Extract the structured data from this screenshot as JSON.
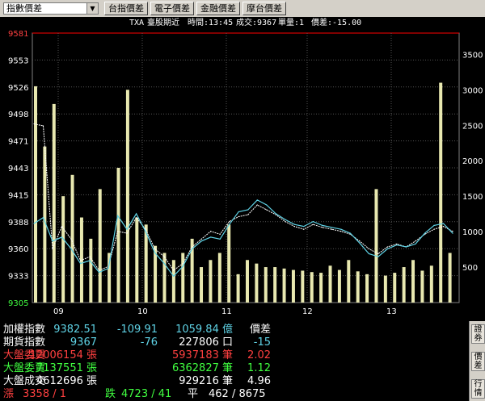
{
  "toolbar": {
    "select_value": "指數價差",
    "buttons": [
      "台指價差",
      "電子價差",
      "金融價差",
      "摩台價差"
    ]
  },
  "header": {
    "symbol": "TXA",
    "name": "臺股期近",
    "time": "時間:13:45",
    "volume": "成交:9367",
    "unit": "單量:1",
    "spread": "價差:-15.00"
  },
  "chart_data": {
    "type": "line",
    "y_ticks": [
      "9581",
      "9553",
      "9526",
      "9498",
      "9471",
      "9443",
      "9415",
      "9388",
      "9360",
      "9333",
      "9305"
    ],
    "y_range": [
      9305,
      9581
    ],
    "y2_ticks": [
      "3500",
      "3000",
      "2500",
      "2000",
      "1500",
      "1000",
      "500"
    ],
    "y2_range": [
      0,
      3800
    ],
    "x_ticks": [
      "09",
      "10",
      "11",
      "12",
      "13"
    ],
    "series": [
      {
        "color": "#ffffff",
        "values": [
          9488,
          9486,
          9360,
          9383,
          9370,
          9348,
          9352,
          9338,
          9342,
          9378,
          9376,
          9392,
          9380,
          9360,
          9352,
          9338,
          9345,
          9362,
          9370,
          9378,
          9375,
          9388,
          9393,
          9395,
          9405,
          9400,
          9395,
          9388,
          9383,
          9380,
          9385,
          9382,
          9380,
          9378,
          9375,
          9368,
          9360,
          9355,
          9362,
          9365,
          9362,
          9368,
          9375,
          9380,
          9383,
          9378
        ]
      },
      {
        "color": "#5fd3e6",
        "values": [
          9386,
          9392,
          9368,
          9372,
          9360,
          9345,
          9348,
          9336,
          9340,
          9394,
          9380,
          9396,
          9378,
          9356,
          9345,
          9332,
          9342,
          9360,
          9368,
          9372,
          9370,
          9385,
          9398,
          9400,
          9410,
          9405,
          9396,
          9390,
          9385,
          9383,
          9388,
          9384,
          9382,
          9380,
          9376,
          9366,
          9355,
          9352,
          9360,
          9364,
          9362,
          9365,
          9376,
          9384,
          9386,
          9376
        ]
      }
    ],
    "volume_bars": [
      3050,
      2200,
      2800,
      1500,
      1800,
      1200,
      900,
      1600,
      700,
      1900,
      3000,
      1200,
      1100,
      800,
      700,
      600,
      700,
      900,
      500,
      600,
      700,
      1100,
      400,
      600,
      550,
      500,
      500,
      480,
      460,
      450,
      430,
      420,
      520,
      460,
      600,
      440,
      400,
      1600,
      380,
      420,
      500,
      600,
      450,
      520,
      3100,
      700
    ]
  },
  "info": {
    "rows": [
      {
        "label": "加權指數",
        "label_color": "#ffffff",
        "cols": [
          {
            "text": "9382.51",
            "color": "#5fd3e6"
          },
          {
            "text": "-109.91",
            "color": "#5fd3e6"
          },
          {
            "text": "1059.84 億",
            "color": "#5fd3e6"
          },
          {
            "text": "價差",
            "color": "#ffffff"
          }
        ]
      },
      {
        "label": "期貨指數",
        "label_color": "#ffffff",
        "cols": [
          {
            "text": "9367",
            "color": "#5fd3e6"
          },
          {
            "text": "-76",
            "color": "#5fd3e6"
          },
          {
            "text": "227806 口",
            "color": "#ffffff"
          },
          {
            "text": "-15",
            "color": "#5fd3e6"
          }
        ]
      },
      {
        "label": "大盤委買",
        "label_color": "#ff4040",
        "cols": [
          {
            "text": "12006154 張",
            "color": "#ff4040"
          },
          {
            "text": "",
            "color": "#ff4040"
          },
          {
            "text": "5937183 筆",
            "color": "#ff4040"
          },
          {
            "text": "2.02",
            "color": "#ff4040"
          }
        ]
      },
      {
        "label": "大盤委賣",
        "label_color": "#40ff40",
        "cols": [
          {
            "text": "7137551 張",
            "color": "#40ff40"
          },
          {
            "text": "",
            "color": "#40ff40"
          },
          {
            "text": "6362827 筆",
            "color": "#40ff40"
          },
          {
            "text": "1.12",
            "color": "#40ff40"
          }
        ]
      },
      {
        "label": "大盤成交",
        "label_color": "#ffffff",
        "cols": [
          {
            "text": "4612696 張",
            "color": "#ffffff"
          },
          {
            "text": "",
            "color": "#ffffff"
          },
          {
            "text": "929216 筆",
            "color": "#ffffff"
          },
          {
            "text": "4.96",
            "color": "#ffffff"
          }
        ]
      }
    ],
    "bottom": {
      "up_label": "漲",
      "up_value": "3358 / 1",
      "down_label": "跌",
      "down_value": "4723 / 41",
      "flat_label": "平",
      "flat_value": "462 / 8675"
    }
  },
  "side_tabs": [
    "證券",
    "價差",
    "行情"
  ]
}
